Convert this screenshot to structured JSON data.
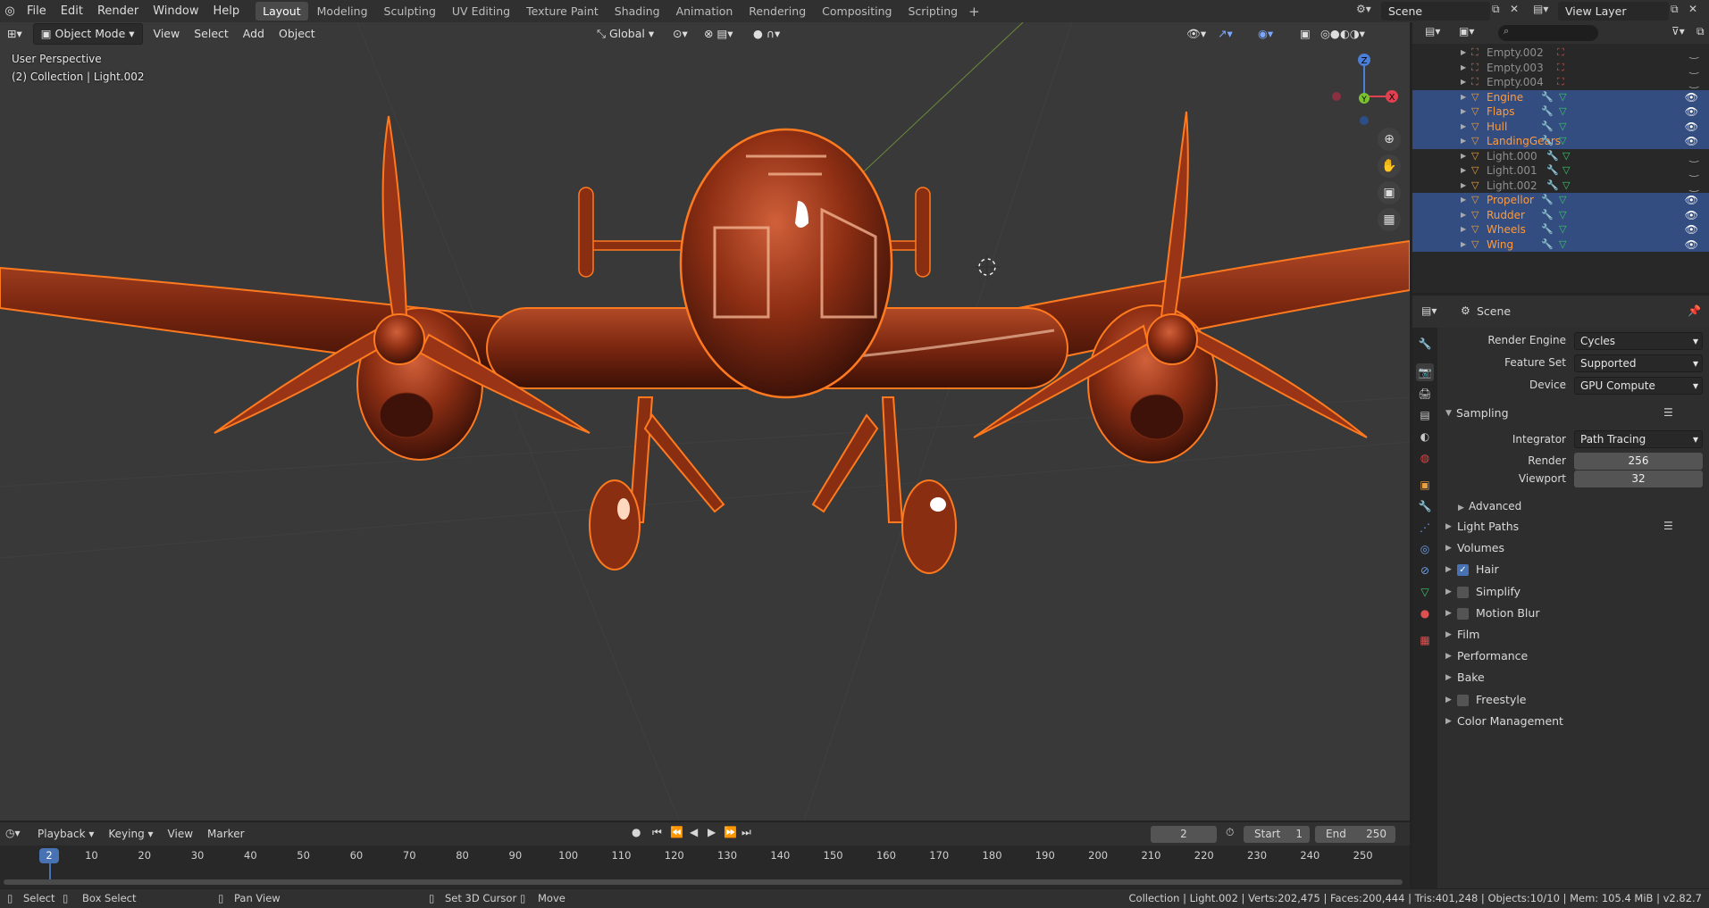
{
  "topbar": {
    "menus": [
      "File",
      "Edit",
      "Render",
      "Window",
      "Help"
    ],
    "workspaces": [
      "Layout",
      "Modeling",
      "Sculpting",
      "UV Editing",
      "Texture Paint",
      "Shading",
      "Animation",
      "Rendering",
      "Compositing",
      "Scripting"
    ],
    "active_workspace": "Layout",
    "add_tab": "+",
    "scene": "Scene",
    "view_layer": "View Layer"
  },
  "viewport_header": {
    "mode": "Object Mode",
    "menus": [
      "View",
      "Select",
      "Add",
      "Object"
    ],
    "transform_orientation": "Global"
  },
  "viewport": {
    "perspective": "User Perspective",
    "collection_info": "(2) Collection | Light.002",
    "gizmo": {
      "z": "Z",
      "y": "Y",
      "x": "X"
    }
  },
  "outliner": {
    "items": [
      {
        "name": "Empty.002",
        "selected": false
      },
      {
        "name": "Empty.003",
        "selected": false
      },
      {
        "name": "Empty.004",
        "selected": false
      },
      {
        "name": "Engine",
        "selected": true
      },
      {
        "name": "Flaps",
        "selected": true
      },
      {
        "name": "Hull",
        "selected": true
      },
      {
        "name": "LandingGears",
        "selected": true
      },
      {
        "name": "Light.000",
        "selected": false
      },
      {
        "name": "Light.001",
        "selected": false
      },
      {
        "name": "Light.002",
        "selected": false
      },
      {
        "name": "Propellor",
        "selected": true
      },
      {
        "name": "Rudder",
        "selected": true
      },
      {
        "name": "Wheels",
        "selected": true
      },
      {
        "name": "Wing",
        "selected": true
      }
    ]
  },
  "properties": {
    "context": "Scene",
    "render_engine_label": "Render Engine",
    "render_engine": "Cycles",
    "feature_set_label": "Feature Set",
    "feature_set": "Supported",
    "device_label": "Device",
    "device": "GPU Compute",
    "sampling": "Sampling",
    "integrator_label": "Integrator",
    "integrator": "Path Tracing",
    "render_label": "Render",
    "render_samples": "256",
    "viewport_label": "Viewport",
    "viewport_samples": "32",
    "advanced": "Advanced",
    "sections": [
      {
        "label": "Light Paths",
        "checkbox": null
      },
      {
        "label": "Volumes",
        "checkbox": null
      },
      {
        "label": "Hair",
        "checkbox": true
      },
      {
        "label": "Simplify",
        "checkbox": false
      },
      {
        "label": "Motion Blur",
        "checkbox": false
      },
      {
        "label": "Film",
        "checkbox": null
      },
      {
        "label": "Performance",
        "checkbox": null
      },
      {
        "label": "Bake",
        "checkbox": null
      },
      {
        "label": "Freestyle",
        "checkbox": false
      },
      {
        "label": "Color Management",
        "checkbox": null
      }
    ]
  },
  "timeline": {
    "menus": [
      "Playback",
      "Keying",
      "View",
      "Marker"
    ],
    "current_frame": "2",
    "start_label": "Start",
    "start": "1",
    "end_label": "End",
    "end": "250",
    "ticks": [
      "10",
      "20",
      "30",
      "40",
      "50",
      "60",
      "70",
      "80",
      "90",
      "100",
      "110",
      "120",
      "130",
      "140",
      "150",
      "160",
      "170",
      "180",
      "190",
      "200",
      "210",
      "220",
      "230",
      "240",
      "250"
    ]
  },
  "statusbar": {
    "select": "Select",
    "box_select": "Box Select",
    "pan_view": "Pan View",
    "set_cursor": "Set 3D Cursor",
    "move": "Move",
    "stats": "Collection | Light.002 | Verts:202,475 | Faces:200,444 | Tris:401,248 | Objects:10/10 | Mem: 105.4 MiB | v2.82.7"
  },
  "colors": {
    "selected_row": "#334d80",
    "accent": "#4772b3",
    "plane": "#8a2e12",
    "outline": "#ff7a1f"
  }
}
